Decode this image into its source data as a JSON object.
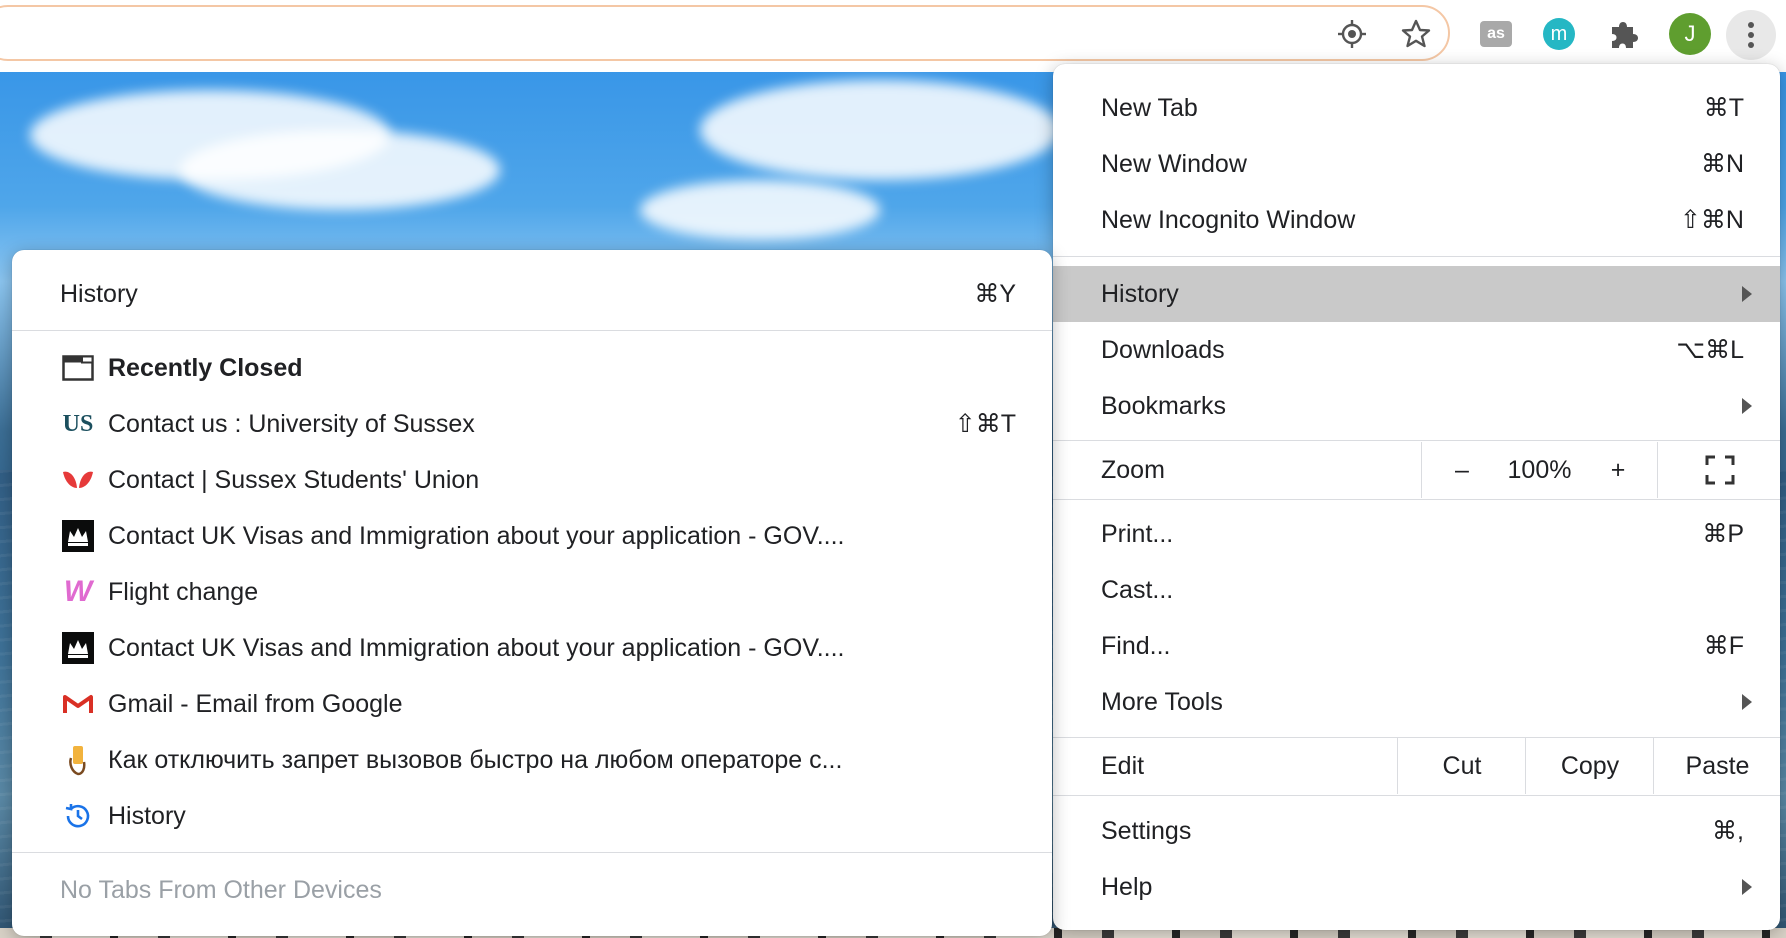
{
  "toolbar": {
    "extensions": {
      "lastfm_label": "as",
      "m_label": "m",
      "avatar_initial": "J"
    }
  },
  "main_menu": {
    "items": [
      {
        "label": "New Tab",
        "shortcut": "⌘T"
      },
      {
        "label": "New Window",
        "shortcut": "⌘N"
      },
      {
        "label": "New Incognito Window",
        "shortcut": "⇧⌘N"
      }
    ],
    "history": {
      "label": "History"
    },
    "downloads": {
      "label": "Downloads",
      "shortcut": "⌥⌘L"
    },
    "bookmarks": {
      "label": "Bookmarks"
    },
    "zoom": {
      "label": "Zoom",
      "minus": "–",
      "level": "100%",
      "plus": "+"
    },
    "print": {
      "label": "Print...",
      "shortcut": "⌘P"
    },
    "cast": {
      "label": "Cast..."
    },
    "find": {
      "label": "Find...",
      "shortcut": "⌘F"
    },
    "more_tools": {
      "label": "More Tools"
    },
    "edit": {
      "label": "Edit",
      "cut": "Cut",
      "copy": "Copy",
      "paste": "Paste"
    },
    "settings": {
      "label": "Settings",
      "shortcut": "⌘,"
    },
    "help": {
      "label": "Help"
    }
  },
  "history_menu": {
    "header": {
      "label": "History",
      "shortcut": "⌘Y"
    },
    "recently_closed": {
      "label": "Recently Closed"
    },
    "entries": [
      {
        "label": "Contact us : University of Sussex",
        "shortcut": "⇧⌘T",
        "icon": "sussex-us-icon",
        "icon_text": "US"
      },
      {
        "label": "Contact | Sussex Students' Union",
        "shortcut": "",
        "icon": "sussex-su-icon"
      },
      {
        "label": "Contact UK Visas and Immigration about your application - GOV....",
        "shortcut": "",
        "icon": "gov-uk-crown-icon"
      },
      {
        "label": "Flight change",
        "shortcut": "",
        "icon": "wizz-w-icon",
        "icon_text": "W"
      },
      {
        "label": "Contact UK Visas and Immigration about your application - GOV....",
        "shortcut": "",
        "icon": "gov-uk-crown-icon"
      },
      {
        "label": "Gmail - Email from Google",
        "shortcut": "",
        "icon": "gmail-icon"
      },
      {
        "label": "Как отключить запрет вызовов быстро на любом операторе с...",
        "shortcut": "",
        "icon": "phone-hand-icon"
      }
    ],
    "history_link": {
      "label": "History"
    },
    "other_devices": {
      "label": "No Tabs From Other Devices"
    }
  },
  "colors": {
    "menu_highlight": "#c9c9c9",
    "avatar_bg": "#5f9e2f",
    "m_ext_bg": "#25b7c4",
    "omnibox_border": "#f4c7a5",
    "disabled_text": "#9aa0a6"
  }
}
